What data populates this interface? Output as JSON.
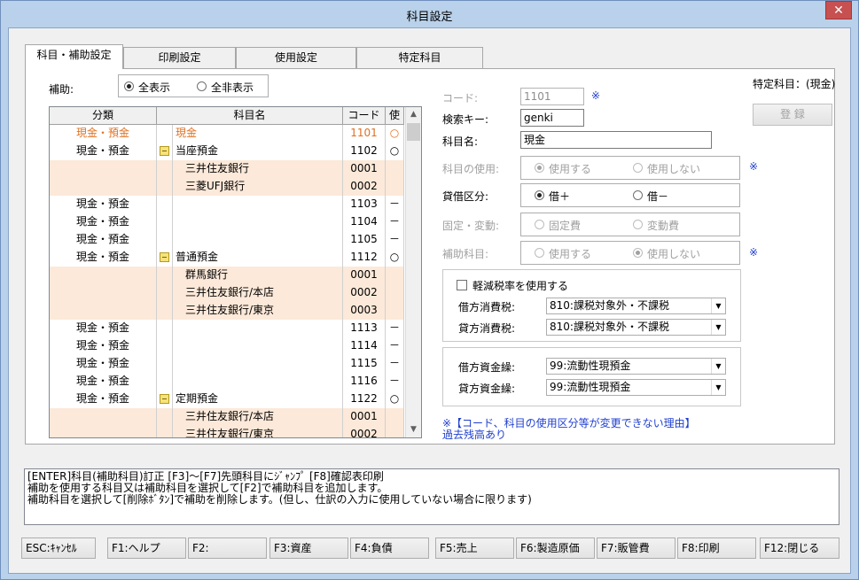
{
  "window": {
    "title": "科目設定",
    "close": "✕"
  },
  "tabs": [
    "科目・補助設定",
    "印刷設定",
    "使用設定",
    "特定科目"
  ],
  "hojo": {
    "label": "補助:",
    "opt_all": "全表示",
    "opt_none": "全非表示"
  },
  "grid": {
    "headers": [
      "分類",
      "科目名",
      "コード",
      "使"
    ],
    "rows": [
      {
        "cat": "現金・預金",
        "name": "現金",
        "code": "1101",
        "use": "○",
        "kind": "main",
        "selected": true
      },
      {
        "cat": "現金・預金",
        "name": "当座預金",
        "code": "1102",
        "use": "○",
        "kind": "main",
        "icon": true
      },
      {
        "cat": "",
        "name": "三井住友銀行",
        "code": "0001",
        "use": "",
        "kind": "sub"
      },
      {
        "cat": "",
        "name": "三菱UFJ銀行",
        "code": "0002",
        "use": "",
        "kind": "sub"
      },
      {
        "cat": "現金・預金",
        "name": "",
        "code": "1103",
        "use": "－",
        "kind": "main"
      },
      {
        "cat": "現金・預金",
        "name": "",
        "code": "1104",
        "use": "－",
        "kind": "main"
      },
      {
        "cat": "現金・預金",
        "name": "",
        "code": "1105",
        "use": "－",
        "kind": "main"
      },
      {
        "cat": "現金・預金",
        "name": "普通預金",
        "code": "1112",
        "use": "○",
        "kind": "main",
        "icon": true
      },
      {
        "cat": "",
        "name": "群馬銀行",
        "code": "0001",
        "use": "",
        "kind": "sub"
      },
      {
        "cat": "",
        "name": "三井住友銀行/本店",
        "code": "0002",
        "use": "",
        "kind": "sub"
      },
      {
        "cat": "",
        "name": "三井住友銀行/東京",
        "code": "0003",
        "use": "",
        "kind": "sub"
      },
      {
        "cat": "現金・預金",
        "name": "",
        "code": "1113",
        "use": "－",
        "kind": "main"
      },
      {
        "cat": "現金・預金",
        "name": "",
        "code": "1114",
        "use": "－",
        "kind": "main"
      },
      {
        "cat": "現金・預金",
        "name": "",
        "code": "1115",
        "use": "－",
        "kind": "main"
      },
      {
        "cat": "現金・預金",
        "name": "",
        "code": "1116",
        "use": "－",
        "kind": "main"
      },
      {
        "cat": "現金・預金",
        "name": "定期預金",
        "code": "1122",
        "use": "○",
        "kind": "main",
        "icon": true
      },
      {
        "cat": "",
        "name": "三井住友銀行/本店",
        "code": "0001",
        "use": "",
        "kind": "sub"
      },
      {
        "cat": "",
        "name": "三井住友銀行/東京",
        "code": "0002",
        "use": "",
        "kind": "sub"
      }
    ]
  },
  "form": {
    "special_label": "特定科目：(現金)",
    "register": "登 録",
    "code_label": "コード:",
    "code_value": "1101",
    "note_mark": "※",
    "search_label": "検索キー:",
    "search_value": "genki",
    "name_label": "科目名:",
    "name_value": "現金",
    "use_label": "科目の使用:",
    "use_opt1": "使用する",
    "use_opt2": "使用しない",
    "taishaku_label": "貸借区分:",
    "taishaku_opt1": "借＋",
    "taishaku_opt2": "借－",
    "kotei_label": "固定・変動:",
    "kotei_opt1": "固定費",
    "kotei_opt2": "変動費",
    "hojo_label": "補助科目:",
    "hojo_opt1": "使用する",
    "hojo_opt2": "使用しない",
    "reduced_label": "軽減税率を使用する",
    "karikata_tax_label": "借方消費税:",
    "karikata_tax_value": "810:課税対象外・不課税",
    "kashikata_tax_label": "貸方消費税:",
    "kashikata_tax_value": "810:課税対象外・不課税",
    "karikata_fund_label": "借方資金繰:",
    "karikata_fund_value": "99:流動性現預金",
    "kashikata_fund_label": "貸方資金繰:",
    "kashikata_fund_value": "99:流動性現預金",
    "reason_line1": "※【コード、科目の使用区分等が変更できない理由】",
    "reason_line2": "過去残高あり"
  },
  "message": {
    "line1": "[ENTER]科目(補助科目)訂正 [F3]～[F7]先頭科目にｼﾞｬﾝﾌﾟ [F8]確認表印刷",
    "line2": "補助を使用する科目又は補助科目を選択して[F2]で補助科目を追加します。",
    "line3": "補助科目を選択して[削除ﾎﾞﾀﾝ]で補助を削除します。(但し、仕訳の入力に使用していない場合に限ります)"
  },
  "fkeys": [
    "ESC:ｷｬﾝｾﾙ",
    "F1:ヘルプ",
    "F2:",
    "F3:資産",
    "F4:負債",
    "F5:売上",
    "F6:製造原価",
    "F7:販管費",
    "F8:印刷",
    "F12:閉じる"
  ],
  "colors": {
    "sub_row": "#fce9d9",
    "selected_border": "#e8641c",
    "selected_text": "#e07020",
    "note_blue": "#1f3fd0"
  }
}
